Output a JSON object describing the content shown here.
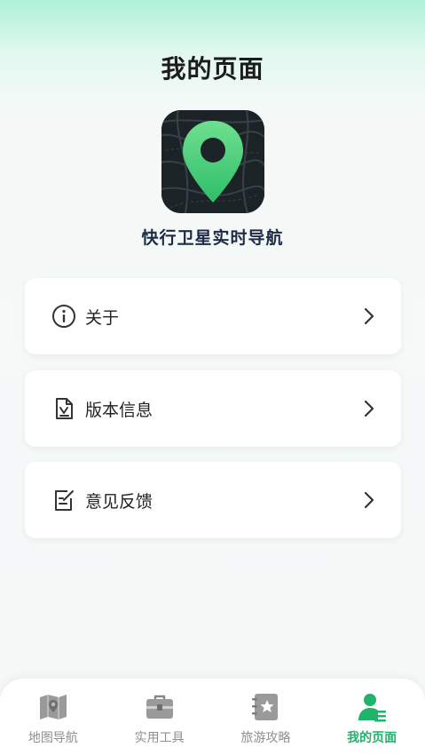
{
  "header": {
    "title": "我的页面"
  },
  "app": {
    "name": "快行卫星实时导航",
    "logo_icon": "map-pin-icon"
  },
  "menu": {
    "about": {
      "label": "关于",
      "icon": "info-icon"
    },
    "version": {
      "label": "版本信息",
      "icon": "document-check-icon"
    },
    "feedback": {
      "label": "意见反馈",
      "icon": "edit-note-icon"
    }
  },
  "tabs": [
    {
      "label": "地图导航",
      "icon": "map-icon",
      "active": false
    },
    {
      "label": "实用工具",
      "icon": "toolbox-icon",
      "active": false
    },
    {
      "label": "旅游攻略",
      "icon": "notebook-star-icon",
      "active": false
    },
    {
      "label": "我的页面",
      "icon": "user-icon",
      "active": true
    }
  ],
  "colors": {
    "accent": "#1fb36b",
    "inactive": "#8f8f8f",
    "logo_bg": "#1b2326"
  }
}
